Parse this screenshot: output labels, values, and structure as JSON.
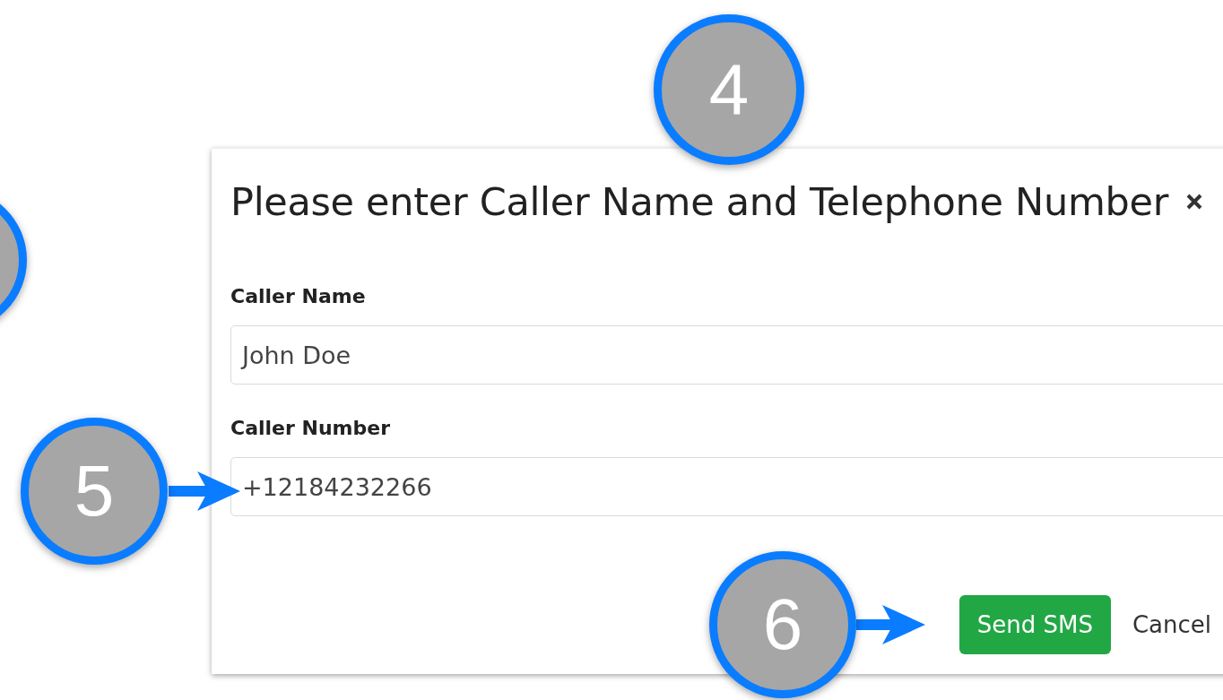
{
  "dialog": {
    "title": "Please enter Caller Name and Telephone Number",
    "fields": [
      {
        "label": "Caller Name",
        "value": "John Doe"
      },
      {
        "label": "Caller Number",
        "value": "+12184232266"
      }
    ],
    "buttons": [
      {
        "label": "Send SMS",
        "kind": "primary"
      },
      {
        "label": "Cancel",
        "kind": "link"
      }
    ]
  },
  "callouts": [
    {
      "kind": "plain"
    },
    {
      "kind": "plain",
      "number": "4"
    },
    {
      "kind": "arrow",
      "number": "5"
    },
    {
      "kind": "arrow",
      "number": "6"
    }
  ]
}
